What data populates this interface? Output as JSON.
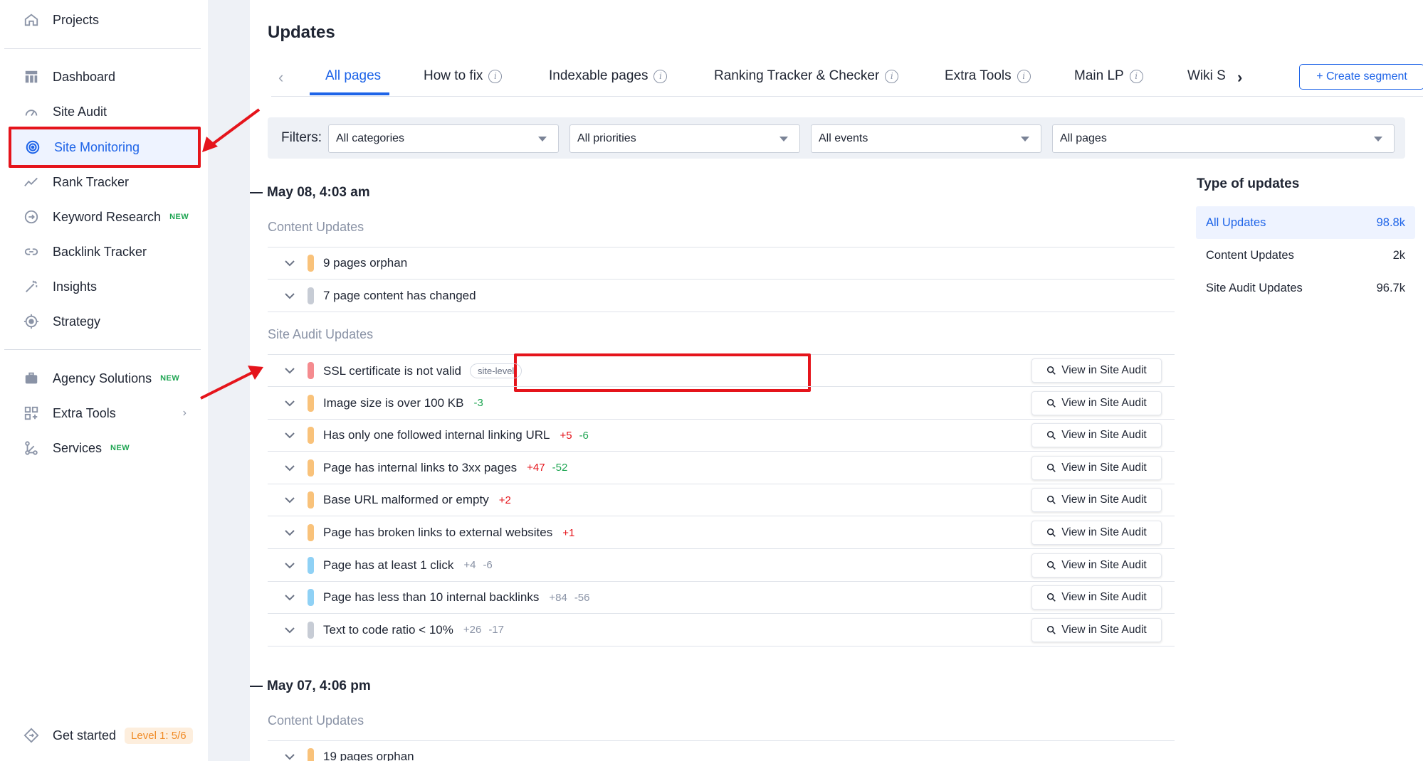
{
  "sidebar": {
    "projects": "Projects",
    "dashboard": "Dashboard",
    "site_audit": "Site Audit",
    "site_monitoring": "Site Monitoring",
    "rank_tracker": "Rank Tracker",
    "keyword_research": "Keyword Research",
    "backlink_tracker": "Backlink Tracker",
    "insights": "Insights",
    "strategy": "Strategy",
    "agency_solutions": "Agency Solutions",
    "extra_tools": "Extra Tools",
    "services": "Services",
    "get_started": "Get started",
    "level": "Level 1: 5/6",
    "new_badge": "NEW"
  },
  "page": {
    "title": "Updates"
  },
  "tabs": {
    "items": [
      "All pages",
      "How to fix",
      "Indexable pages",
      "Ranking Tracker & Checker",
      "Extra Tools",
      "Main LP",
      "Wiki S"
    ],
    "info_icon": "i",
    "create_segment": "+ Create segment"
  },
  "filters": {
    "label": "Filters:",
    "categories": "All categories",
    "priorities": "All priorities",
    "events": "All events",
    "pages": "All pages"
  },
  "groups": [
    {
      "date": "May 08, 4:03 am",
      "content_label": "Content Updates",
      "content_rows": [
        {
          "label": "9 pages orphan",
          "color": "#f9c27a"
        },
        {
          "label": "7 page content has changed",
          "color": "#c7ccd5"
        }
      ],
      "audit_label": "Site Audit Updates",
      "audit_rows": [
        {
          "label": "SSL certificate is not valid",
          "tag": "site-level",
          "color": "#f58b8f"
        },
        {
          "label": "Image size is over 100 KB",
          "d1": "-3",
          "color": "#f9c27a"
        },
        {
          "label": "Has only one followed internal linking URL",
          "d1": "+5",
          "d2": "-6",
          "color": "#f9c27a"
        },
        {
          "label": "Page has internal links to 3xx pages",
          "d1": "+47",
          "d2": "-52",
          "color": "#f9c27a"
        },
        {
          "label": "Base URL malformed or empty",
          "d1": "+2",
          "color": "#f9c27a"
        },
        {
          "label": "Page has broken links to external websites",
          "d1": "+1",
          "color": "#f9c27a"
        },
        {
          "label": "Page has at least 1 click",
          "d1": "+4",
          "d2": "-6",
          "color": "#8fd1f5"
        },
        {
          "label": "Page has less than 10 internal backlinks",
          "d1": "+84",
          "d2": "-56",
          "color": "#8fd1f5"
        },
        {
          "label": "Text to code ratio < 10%",
          "d1": "+26",
          "d2": "-17",
          "color": "#c7ccd5"
        }
      ],
      "view_label": "View in Site Audit"
    },
    {
      "date": "May 07, 4:06 pm",
      "content_label": "Content Updates",
      "content_rows": [
        {
          "label": "19 pages orphan",
          "color": "#f9c27a"
        }
      ]
    }
  ],
  "type_of_updates": {
    "title": "Type of updates",
    "items": [
      {
        "label": "All Updates",
        "value": "98.8k"
      },
      {
        "label": "Content Updates",
        "value": "2k"
      },
      {
        "label": "Site Audit Updates",
        "value": "96.7k"
      }
    ]
  },
  "colors": {
    "accent": "#1e64e8",
    "annotation": "#e5141b"
  }
}
